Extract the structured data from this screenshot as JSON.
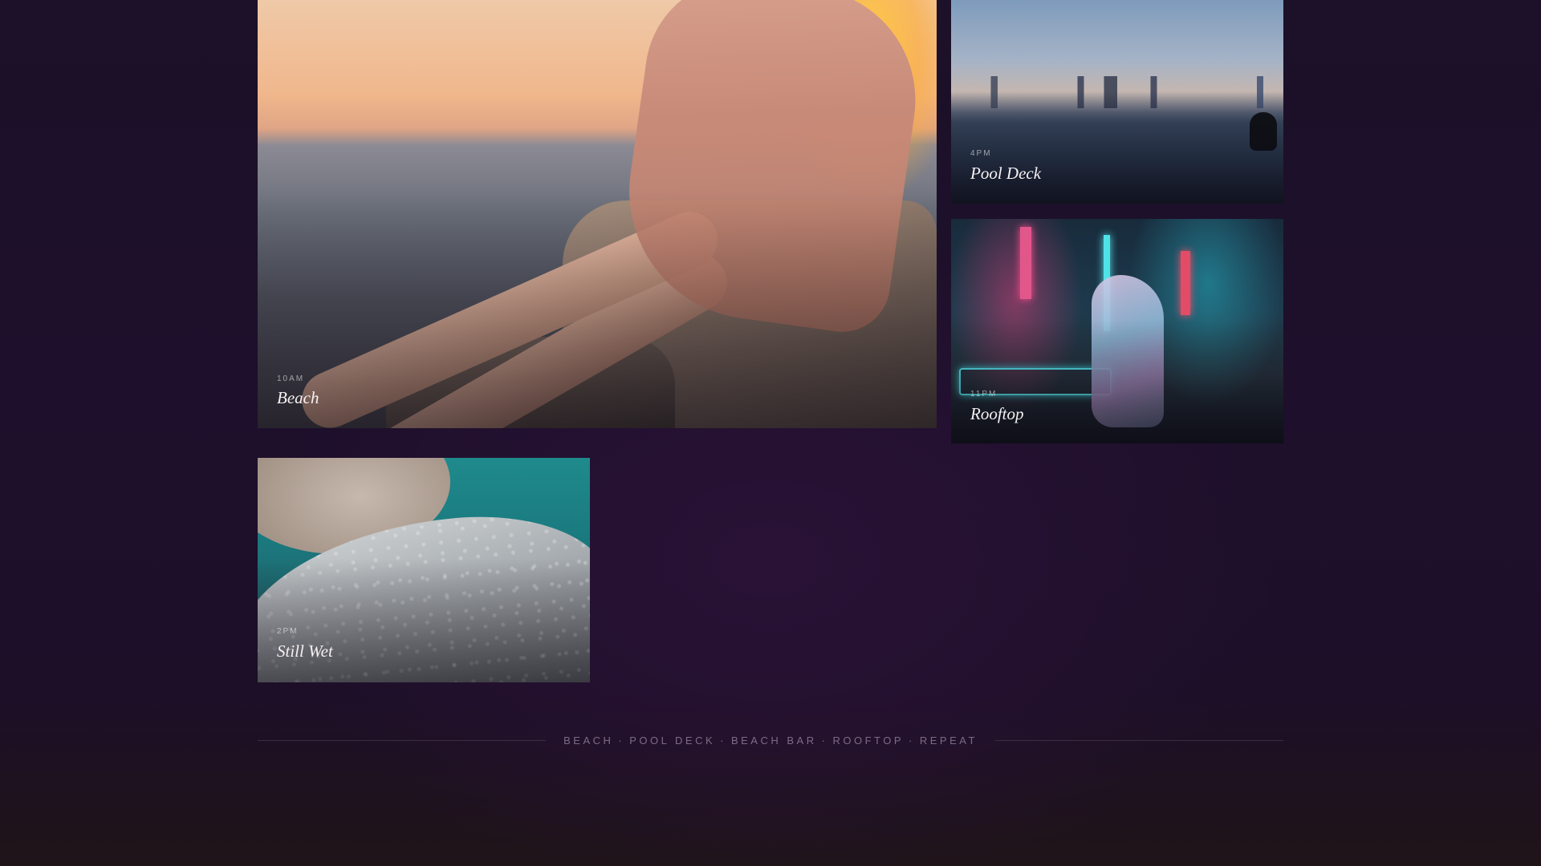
{
  "cards": [
    {
      "time": "10AM",
      "title": "Beach"
    },
    {
      "time": "4PM",
      "title": "Pool Deck"
    },
    {
      "time": "11PM",
      "title": "Rooftop"
    },
    {
      "time": "2PM",
      "title": "Still Wet"
    }
  ],
  "footer": {
    "items": [
      "BEACH",
      "POOL DECK",
      "BEACH BAR",
      "ROOFTOP",
      "REPEAT"
    ],
    "separator": "·"
  },
  "colors": {
    "background": "#1d0f2a",
    "title_text": "#f5f1f3",
    "footer_text": "#c8b4d2"
  }
}
